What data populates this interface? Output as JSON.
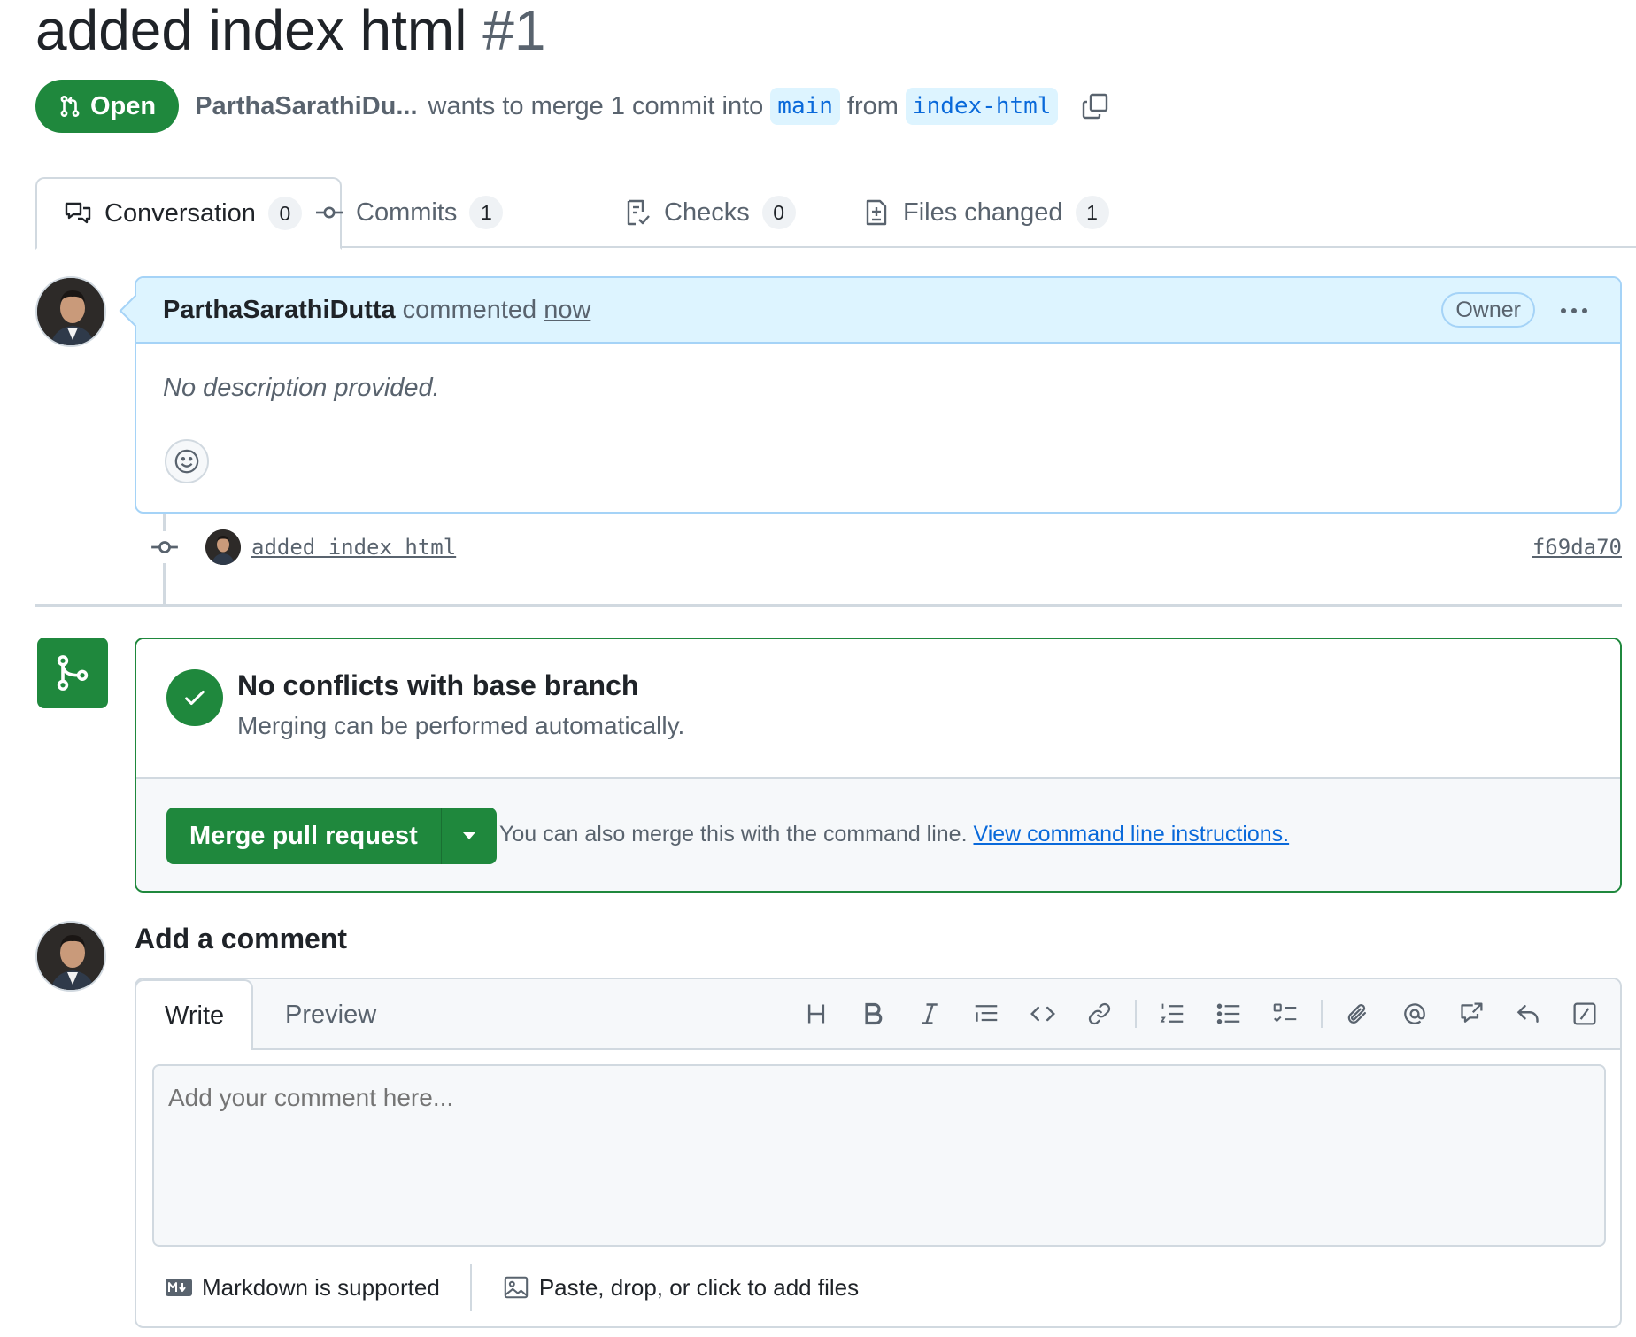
{
  "pr": {
    "title": "added index html",
    "number": "#1",
    "state": "Open",
    "author": "ParthaSarathiDu...",
    "merge_text": "wants to merge 1 commit into",
    "base_branch": "main",
    "from_text": "from",
    "head_branch": "index-html"
  },
  "tabs": [
    {
      "label": "Conversation",
      "count": "0"
    },
    {
      "label": "Commits",
      "count": "1"
    },
    {
      "label": "Checks",
      "count": "0"
    },
    {
      "label": "Files changed",
      "count": "1"
    }
  ],
  "comment": {
    "author": "ParthaSarathiDutta",
    "action": "commented",
    "time": "now",
    "role": "Owner",
    "body": "No description provided."
  },
  "commit": {
    "message": "added index html",
    "sha": "f69da70"
  },
  "merge": {
    "title": "No conflicts with base branch",
    "subtitle": "Merging can be performed automatically.",
    "button_label": "Merge pull request",
    "note": "You can also merge this with the command line.",
    "link": "View command line instructions."
  },
  "add_comment": {
    "title": "Add a comment",
    "write_tab": "Write",
    "preview_tab": "Preview",
    "placeholder": "Add your comment here...",
    "markdown_note": "Markdown is supported",
    "files_note": "Paste, drop, or click to add files"
  },
  "colors": {
    "accent_green": "#1f883d",
    "link_blue": "#0969da",
    "comment_header_bg": "#ddf4ff"
  },
  "icons": {
    "state": "git-pull-request-icon",
    "copy": "copy-icon",
    "conversation": "comment-discussion-icon",
    "commits": "git-commit-icon",
    "checks": "checklist-icon",
    "files": "file-diff-icon",
    "merge": "git-merge-icon",
    "check": "check-icon"
  }
}
